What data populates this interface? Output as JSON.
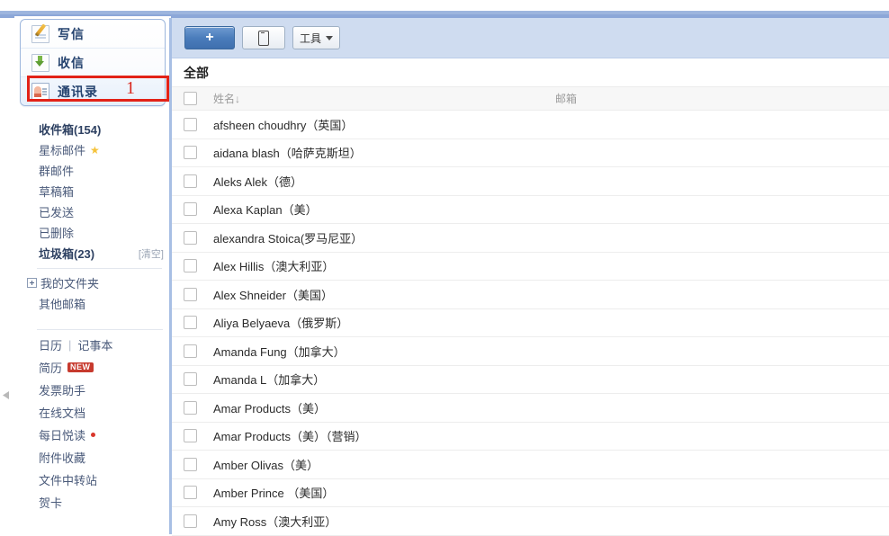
{
  "nav": {
    "items": [
      {
        "label": "写信",
        "icon": "compose-icon",
        "active": false
      },
      {
        "label": "收信",
        "icon": "inbox-icon",
        "active": false
      },
      {
        "label": "通讯录",
        "icon": "contacts-icon",
        "active": true
      }
    ]
  },
  "annotation": {
    "number": "1",
    "color": "#e22217"
  },
  "folders": [
    {
      "label": "收件箱(154)",
      "bold": true,
      "star": false,
      "action": ""
    },
    {
      "label": "星标邮件",
      "bold": false,
      "star": true,
      "action": ""
    },
    {
      "label": "群邮件",
      "bold": false,
      "star": false,
      "action": ""
    },
    {
      "label": "草稿箱",
      "bold": false,
      "star": false,
      "action": ""
    },
    {
      "label": "已发送",
      "bold": false,
      "star": false,
      "action": ""
    },
    {
      "label": "已删除",
      "bold": false,
      "star": false,
      "action": ""
    },
    {
      "label": "垃圾箱(23)",
      "bold": true,
      "star": false,
      "action": "[清空]"
    }
  ],
  "my_folders": {
    "label": "我的文件夹"
  },
  "other_mailbox": {
    "label": "其他邮箱"
  },
  "tools": {
    "calendar": "日历",
    "separator": "|",
    "notepad": "记事本",
    "items": [
      {
        "label": "简历",
        "badge": "NEW",
        "dot": false
      },
      {
        "label": "发票助手",
        "badge": "",
        "dot": false
      },
      {
        "label": "在线文档",
        "badge": "",
        "dot": false
      },
      {
        "label": "每日悦读",
        "badge": "",
        "dot": true
      },
      {
        "label": "附件收藏",
        "badge": "",
        "dot": false
      },
      {
        "label": "文件中转站",
        "badge": "",
        "dot": false
      },
      {
        "label": "贺卡",
        "badge": "",
        "dot": false
      }
    ]
  },
  "toolbar": {
    "add_label": "+",
    "phone_icon": "mobile-phone-icon",
    "tools_label": "工具"
  },
  "list": {
    "group_title": "全部",
    "columns": {
      "name": "姓名↓",
      "email": "邮箱"
    },
    "contacts": [
      {
        "name": "afsheen choudhry（英国）",
        "email": ""
      },
      {
        "name": "aidana blash（哈萨克斯坦）",
        "email": ""
      },
      {
        "name": "Aleks Alek（德）",
        "email": ""
      },
      {
        "name": " Alexa Kaplan（美）",
        "email": ""
      },
      {
        "name": "alexandra Stoica(罗马尼亚）",
        "email": ""
      },
      {
        "name": "Alex Hillis（澳大利亚）",
        "email": ""
      },
      {
        "name": "Alex Shneider（美国）",
        "email": ""
      },
      {
        "name": "Aliya Belyaeva（俄罗斯）",
        "email": ""
      },
      {
        "name": "Amanda Fung（加拿大）",
        "email": ""
      },
      {
        "name": "Amanda L（加拿大）",
        "email": ""
      },
      {
        "name": "Amar Products（美）",
        "email": ""
      },
      {
        "name": "Amar Products（美）（营销）",
        "email": ""
      },
      {
        "name": " Amber Olivas（美）",
        "email": ""
      },
      {
        "name": "Amber Prince  （美国）",
        "email": ""
      },
      {
        "name": "Amy Ross（澳大利亚）",
        "email": ""
      }
    ]
  },
  "colors": {
    "accent_blue": "#4a7cbb",
    "toolbar_bg": "#cfdcf0",
    "sidebar_border": "#a8bfe4",
    "annotation_red": "#e22217",
    "badge_red": "#c73a2e"
  }
}
